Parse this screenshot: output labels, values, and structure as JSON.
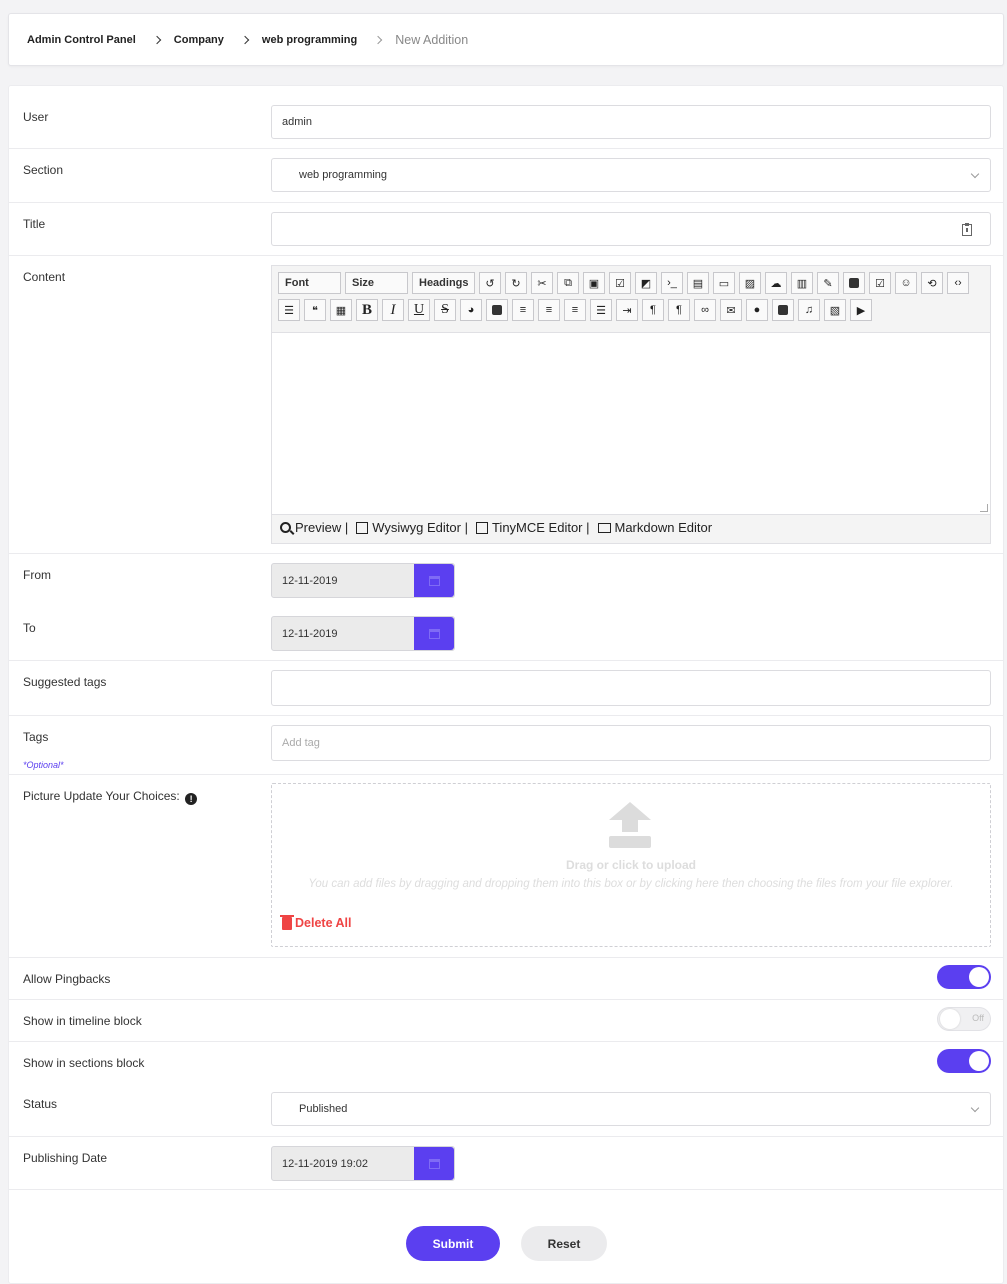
{
  "breadcrumb": {
    "items": [
      "Admin Control Panel",
      "Company",
      "web programming"
    ],
    "current": "New Addition"
  },
  "form": {
    "user": {
      "label": "User",
      "value": "admin"
    },
    "section": {
      "label": "Section",
      "value": "web programming"
    },
    "title": {
      "label": "Title",
      "value": ""
    },
    "content": {
      "label": "Content",
      "toolbar": {
        "font": "Font",
        "size": "Size",
        "headings": "Headings"
      },
      "footer": {
        "preview": "Preview |",
        "wysiwyg": "Wysiwyg Editor |",
        "tinymce": "TinyMCE Editor |",
        "markdown": "Markdown Editor"
      }
    },
    "from": {
      "label": "From",
      "value": "12-11-2019"
    },
    "to": {
      "label": "To",
      "value": "12-11-2019"
    },
    "suggested_tags": {
      "label": "Suggested tags",
      "value": ""
    },
    "tags": {
      "label": "Tags",
      "optional": "*Optional*",
      "placeholder": "Add tag"
    },
    "picture": {
      "label": "Picture Update Your Choices:",
      "upload_title": "Drag or click to upload",
      "upload_hint": "You can add files by dragging and dropping them into this box or by clicking here then choosing the files from your file explorer.",
      "delete_all": "Delete All"
    },
    "allow_pingbacks": {
      "label": "Allow Pingbacks",
      "on": true
    },
    "timeline_block": {
      "label": "Show in timeline block",
      "on": false,
      "off_text": "Off"
    },
    "sections_block": {
      "label": "Show in sections block",
      "on": true
    },
    "status": {
      "label": "Status",
      "value": "Published"
    },
    "publishing_date": {
      "label": "Publishing Date",
      "value": "12-11-2019 19:02"
    },
    "submit": "Submit",
    "reset": "Reset"
  },
  "colors": {
    "accent": "#5b3ff0",
    "danger": "#ef4444"
  }
}
